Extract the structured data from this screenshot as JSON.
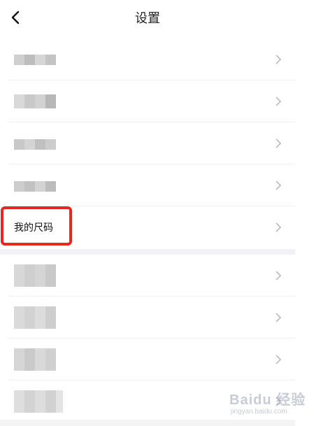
{
  "header": {
    "title": "设置",
    "back_icon": "chevron-left-icon"
  },
  "highlighted_item": {
    "label": "我的尺码"
  },
  "rows": [
    {
      "label": "",
      "blurred": true
    },
    {
      "label": "",
      "blurred": true
    },
    {
      "label": "",
      "blurred": true
    },
    {
      "label": "",
      "blurred": true
    },
    {
      "label": "我的尺码",
      "blurred": false,
      "highlighted": true
    },
    {
      "label": "",
      "blurred": true
    },
    {
      "label": "",
      "blurred": true
    },
    {
      "label": "",
      "blurred": true
    },
    {
      "label": "",
      "blurred": true
    }
  ],
  "watermark": {
    "brand": "Baidu 经验",
    "url": "jingyan.baidu.com"
  },
  "colors": {
    "highlight": "#e8271f",
    "divider": "#f0f0f3",
    "chevron": "#b5b5b5"
  }
}
